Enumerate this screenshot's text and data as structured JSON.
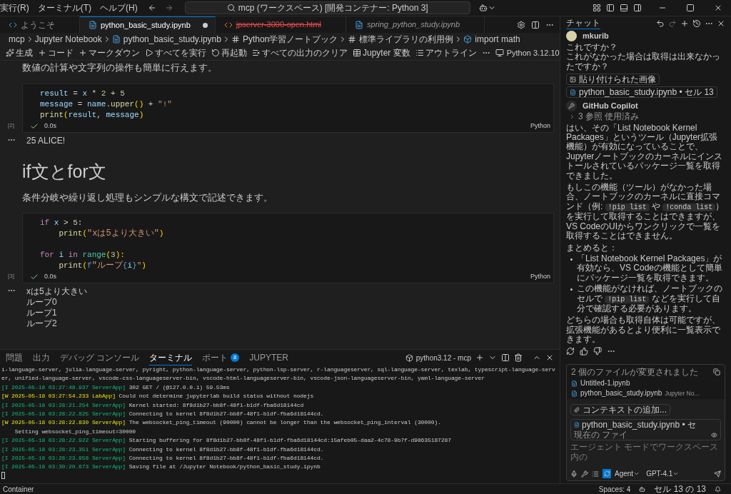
{
  "menu": [
    "実行(R)",
    "ターミナル(T)",
    "ヘルプ(H)"
  ],
  "command_center": "mcp (ワークスペース) [開発コンテナー: Python 3]",
  "tabs": [
    {
      "label": "ようこそ",
      "kind": "welcome",
      "selected": false,
      "dirty": false
    },
    {
      "label": "python_basic_study.ipynb",
      "kind": "notebook",
      "selected": true,
      "dirty": true
    },
    {
      "label": "jpserver-3000-open.html",
      "kind": "deleted_html",
      "selected": false,
      "dirty": false
    },
    {
      "label": "spring_python_study.ipynb",
      "kind": "preview_notebook",
      "selected": false,
      "dirty": false
    }
  ],
  "breadcrumb": [
    {
      "label": "mcp",
      "kind": "folder"
    },
    {
      "label": "Jupyter Notebook",
      "kind": "folder"
    },
    {
      "label": "python_basic_study.ipynb",
      "kind": "notebook"
    },
    {
      "label": "Python学習ノートブック",
      "kind": "markdown"
    },
    {
      "label": "標準ライブラリの利用例",
      "kind": "markdown"
    },
    {
      "label": "import math",
      "kind": "code"
    }
  ],
  "toolbar": [
    {
      "label": "生成",
      "kind": "generate"
    },
    {
      "label": "コード",
      "kind": "add"
    },
    {
      "label": "マークダウン",
      "kind": "add"
    },
    {
      "label": "すべてを実行",
      "kind": "run"
    },
    {
      "label": "再起動",
      "kind": "restart"
    },
    {
      "label": "すべての出力のクリア",
      "kind": "clear"
    },
    {
      "label": "Jupyter 変数",
      "kind": "variables"
    },
    {
      "label": "アウトライン",
      "kind": "outline"
    }
  ],
  "kernel": "Python 3.12.10",
  "cells": [
    {
      "kind": "markdown_text",
      "text": "数値の計算や文字列の操作も簡単に行えます。"
    },
    {
      "kind": "code",
      "count": "[2]",
      "time": "0.0s",
      "language": "Python",
      "succeeded": true,
      "lines": [
        {
          "kind": "code",
          "tokens": [
            {
              "text": "result",
              "kind": "var"
            },
            {
              "text": " =",
              "kind": "op"
            },
            {
              "text": " x",
              "kind": "var"
            },
            {
              "text": " *",
              "kind": "op"
            },
            {
              "text": " 2",
              "kind": "num"
            },
            {
              "text": " +",
              "kind": "op"
            },
            {
              "text": " 5",
              "kind": "num"
            }
          ]
        },
        {
          "kind": "code",
          "tokens": [
            {
              "text": "message",
              "kind": "var"
            },
            {
              "text": " =",
              "kind": "op"
            },
            {
              "text": " name",
              "kind": "var"
            },
            {
              "text": ".",
              "kind": "op"
            },
            {
              "text": "upper",
              "kind": "fn"
            },
            {
              "text": "()",
              "kind": "paren"
            },
            {
              "text": " +",
              "kind": "op"
            },
            {
              "text": " \"!\"",
              "kind": "str"
            }
          ]
        },
        {
          "kind": "code",
          "tokens": [
            {
              "text": "print",
              "kind": "fn"
            },
            {
              "text": "(",
              "kind": "paren"
            },
            {
              "text": "result",
              "kind": "var"
            },
            {
              "text": ",",
              "kind": "op"
            },
            {
              "text": " message",
              "kind": "var"
            },
            {
              "text": ")",
              "kind": "paren"
            }
          ]
        }
      ],
      "output": [
        "25 ALICE!"
      ]
    },
    {
      "kind": "heading",
      "text": "if文とfor文"
    },
    {
      "kind": "markdown_text",
      "text": "条件分岐や繰り返し処理もシンプルな構文で記述できます。"
    },
    {
      "kind": "code",
      "count": "[3]",
      "time": "0.0s",
      "language": "Python",
      "succeeded": true,
      "lines": [
        {
          "kind": "code",
          "tokens": [
            {
              "text": "if",
              "kind": "kw"
            },
            {
              "text": " x",
              "kind": "var"
            },
            {
              "text": " >",
              "kind": "op"
            },
            {
              "text": " 5",
              "kind": "num"
            },
            {
              "text": ":",
              "kind": "op"
            }
          ]
        },
        {
          "kind": "code",
          "tokens": [
            {
              "text": "    print",
              "kind": "fn"
            },
            {
              "text": "(",
              "kind": "paren"
            },
            {
              "text": "\"xは5より大きい\"",
              "kind": "str"
            },
            {
              "text": ")",
              "kind": "paren"
            }
          ]
        },
        {
          "kind": "blank"
        },
        {
          "kind": "code",
          "tokens": [
            {
              "text": "for",
              "kind": "kw"
            },
            {
              "text": " i",
              "kind": "var"
            },
            {
              "text": " in",
              "kind": "kw"
            },
            {
              "text": " range",
              "kind": "builtin"
            },
            {
              "text": "(",
              "kind": "paren"
            },
            {
              "text": "3",
              "kind": "num"
            },
            {
              "text": "):",
              "kind": "paren"
            }
          ]
        },
        {
          "kind": "code",
          "tokens": [
            {
              "text": "    print",
              "kind": "fn"
            },
            {
              "text": "(",
              "kind": "paren"
            },
            {
              "text": "f",
              "kind": "prefix"
            },
            {
              "text": "\"ループ",
              "kind": "str"
            },
            {
              "text": "{",
              "kind": "interp"
            },
            {
              "text": "i",
              "kind": "var"
            },
            {
              "text": "}",
              "kind": "interp"
            },
            {
              "text": "\"",
              "kind": "str"
            },
            {
              "text": ")",
              "kind": "paren"
            }
          ]
        }
      ],
      "output": [
        "xは5より大きい",
        "ループ0",
        "ループ1",
        "ループ2"
      ]
    }
  ],
  "panel_tabs": [
    {
      "label": "問題",
      "selected": false
    },
    {
      "label": "出力",
      "selected": false
    },
    {
      "label": "デバッグ コンソール",
      "selected": false
    },
    {
      "label": "ターミナル",
      "selected": true
    },
    {
      "label": "ポート",
      "selected": false,
      "badge": "8"
    },
    {
      "label": "JUPYTER",
      "selected": false
    }
  ],
  "terminal_name": "python3.12 - mcp",
  "terminal": [
    {
      "kind": "plain",
      "text": "i-language-server, julia-language-server, pyright, python-language-server, python-lsp-server, r-languageserver, sql-language-server, texlab, typescript-language-serv"
    },
    {
      "kind": "plain",
      "text": "er, unified-language-server, vscode-css-languageserver-bin, vscode-html-languageserver-bin, vscode-json-languageserver-bin, yaml-language-server"
    },
    {
      "kind": "info",
      "tag": "[I 2025-05-18 03:27:48.937 ServerApp]",
      "text": " 302 GET / (@127.0.0.1) 59.53ms"
    },
    {
      "kind": "warn",
      "tag": "[W 2025-05-18 03:27:54.233 LabApp]",
      "text": " Could not determine jupyterlab build status without nodejs"
    },
    {
      "kind": "info",
      "tag": "[I 2025-05-18 03:28:21.254 ServerApp]",
      "text": " Kernel started: 8f8d1b27-bb8f-48f1-b1df-fba6d18144cd"
    },
    {
      "kind": "info",
      "tag": "[I 2025-05-18 03:28:22.825 ServerApp]",
      "text": " Connecting to kernel 8f8d1b27-bb8f-48f1-b1df-fba6d18144cd."
    },
    {
      "kind": "warn",
      "tag": "[W 2025-05-18 03:28:22.830 ServerApp]",
      "text": " The websocket_ping_timeout (90000) cannot be longer than the websocket_ping_interval (30000)."
    },
    {
      "kind": "plain",
      "text": "    Setting websocket_ping_timeout=30000"
    },
    {
      "kind": "info",
      "tag": "[I 2025-05-18 03:28:22.922 ServerApp]",
      "text": " Starting buffering for 8f8d1b27-bb8f-48f1-b1df-fba6d18144cd:15afeb05-daa2-4c78-9b7f-d98635187287"
    },
    {
      "kind": "info",
      "tag": "[I 2025-05-18 03:28:23.351 ServerApp]",
      "text": " Connecting to kernel 8f8d1b27-bb8f-48f1-b1df-fba6d18144cd."
    },
    {
      "kind": "info",
      "tag": "[I 2025-05-18 03:28:23.958 ServerApp]",
      "text": " Connecting to kernel 8f8d1b27-bb8f-48f1-b1df-fba6d18144cd."
    },
    {
      "kind": "info",
      "tag": "[I 2025-05-18 03:30:20.673 ServerApp]",
      "text": " Saving file at /Jupyter Notebook/python_basic_study.ipynb"
    }
  ],
  "chat": {
    "tab": "チャット",
    "user": {
      "name": "mkurib",
      "lines": [
        "これですか？",
        "これがなかった場合は取得は出来なかったですか？"
      ],
      "attachments": [
        {
          "label": "貼り付けられた画像",
          "kind": "image"
        },
        {
          "label": "python_basic_study.ipynb • セル 13",
          "kind": "file"
        }
      ]
    },
    "assistant": {
      "name": "GitHub Copilot",
      "references": "3 参照 使用済み",
      "blocks": [
        {
          "kind": "paragraph",
          "parts": [
            {
              "text": "はい、その「List Notebook Kernel Packages」というツール（Jupyter拡張機能）が有効になっていることで、Jupyterノートブックのカーネルにインストールされているパッケージ一覧を取得できました。",
              "code": false
            }
          ]
        },
        {
          "kind": "paragraph",
          "parts": [
            {
              "text": "もしこの機能（ツール）がなかった場合、ノートブックのカーネルに直接コマンド（例: ",
              "code": false
            },
            {
              "text": "!pip list",
              "code": true
            },
            {
              "text": " や ",
              "code": false
            },
            {
              "text": "!conda list",
              "code": true
            },
            {
              "text": "）を実行して取得することはできますが、VS CodeのUIからワンクリックで一覧を取得することはできません。",
              "code": false
            }
          ]
        },
        {
          "kind": "paragraph",
          "parts": [
            {
              "text": "まとめると：",
              "code": false
            }
          ]
        },
        {
          "kind": "bullet",
          "parts": [
            {
              "text": "「List Notebook Kernel Packages」が有効なら、VS Codeの機能として簡単にパッケージ一覧を取得できます。",
              "code": false
            }
          ]
        },
        {
          "kind": "bullet",
          "parts": [
            {
              "text": "この機能がなければ、ノートブックのセルで ",
              "code": false
            },
            {
              "text": "!pip list",
              "code": true
            },
            {
              "text": " などを実行して自分で確認する必要があります。",
              "code": false
            }
          ]
        },
        {
          "kind": "paragraph",
          "parts": [
            {
              "text": "どちらの場合も取得自体は可能ですが、拡張機能があるとより便利に一覧表示できます。",
              "code": false
            }
          ]
        }
      ]
    },
    "changes": {
      "title": "2 個のファイルが変更されました",
      "files": [
        {
          "name": "Untitled-1.ipynb"
        },
        {
          "name": "python_basic_study.ipynb",
          "detail": "Jupyter No..."
        }
      ]
    },
    "add_context": "コンテキストの追加...",
    "current_file": "python_basic_study.ipynb • セ",
    "current_file_note": "現在の ファイ",
    "placeholder": "エージェント モードでワークスペース内の",
    "auto_approve": true,
    "mode": "Agent",
    "model": "GPT-4.1"
  },
  "status": {
    "left": "Container",
    "spaces": "Spaces: 4",
    "cell": "セル 13 の 13"
  }
}
